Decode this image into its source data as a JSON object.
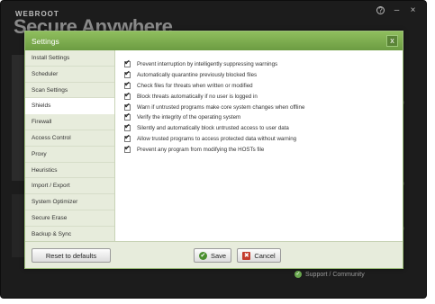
{
  "app": {
    "brand_small": "WEBROOT",
    "brand_large": "Secure Anywhere",
    "footer_link": "Support / Community"
  },
  "window_controls": {
    "help": "?",
    "minimize": "–",
    "close": "×"
  },
  "dialog": {
    "title": "Settings",
    "close_label": "x"
  },
  "sidebar": {
    "items": [
      {
        "label": "Install Settings"
      },
      {
        "label": "Scheduler"
      },
      {
        "label": "Scan Settings"
      },
      {
        "label": "Shields",
        "active": true
      },
      {
        "label": "Firewall"
      },
      {
        "label": "Access Control"
      },
      {
        "label": "Proxy"
      },
      {
        "label": "Heuristics"
      },
      {
        "label": "Import / Export"
      },
      {
        "label": "System Optimizer"
      },
      {
        "label": "Secure Erase"
      },
      {
        "label": "Backup & Sync"
      }
    ]
  },
  "options": [
    {
      "label": "Prevent interruption by intelligently suppressing warnings",
      "checked": true
    },
    {
      "label": "Automatically quarantine previously blocked files",
      "checked": true
    },
    {
      "label": "Check files for threats when written or modified",
      "checked": true
    },
    {
      "label": "Block threats automatically if no user is logged in",
      "checked": true
    },
    {
      "label": "Warn if untrusted programs make core system changes when offline",
      "checked": true
    },
    {
      "label": "Verify the integrity of the operating system",
      "checked": true
    },
    {
      "label": "Silently and automatically block untrusted access to user data",
      "checked": true
    },
    {
      "label": "Allow trusted programs to access protected data without warning",
      "checked": true
    },
    {
      "label": "Prevent any program from modifying the HOSTs file",
      "checked": true
    }
  ],
  "footer": {
    "reset_label": "Reset to defaults",
    "save_label": "Save",
    "cancel_label": "Cancel"
  },
  "colors": {
    "header_green": "#7aab4e",
    "sidebar_bg": "#e7ecdc",
    "save_icon": "#4a8f2e",
    "cancel_icon": "#c33a2b"
  }
}
